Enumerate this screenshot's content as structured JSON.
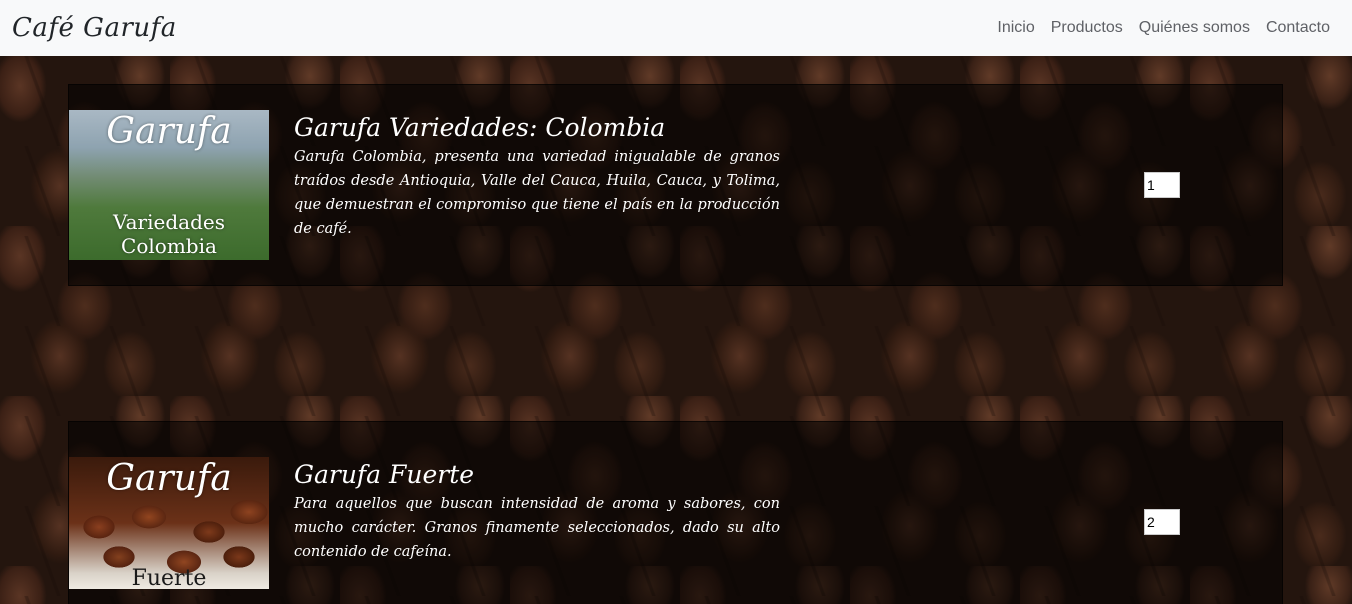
{
  "navbar": {
    "brand": "Café Garufa",
    "links": [
      "Inicio",
      "Productos",
      "Quiénes somos",
      "Contacto"
    ]
  },
  "products": [
    {
      "image_top": "Garufa",
      "image_bottom_line1": "Variedades",
      "image_bottom_line2": "Colombia",
      "title": "Garufa Variedades: Colombia",
      "description": "Garufa Colombia, presenta una variedad inigualable de granos traídos desde Antioquia, Valle del Cauca, Huila, Cauca, y Tolima, que demuestran el compromiso que tiene el país en la producción de café.",
      "quantity": "1"
    },
    {
      "image_top": "Garufa",
      "image_bottom_line1": "Fuerte",
      "title": "Garufa Fuerte",
      "description": "Para aquellos que buscan intensidad de aroma y sabores, con mucho carácter. Granos finamente seleccionados, dado su alto contenido de cafeína.",
      "quantity": "2"
    }
  ]
}
